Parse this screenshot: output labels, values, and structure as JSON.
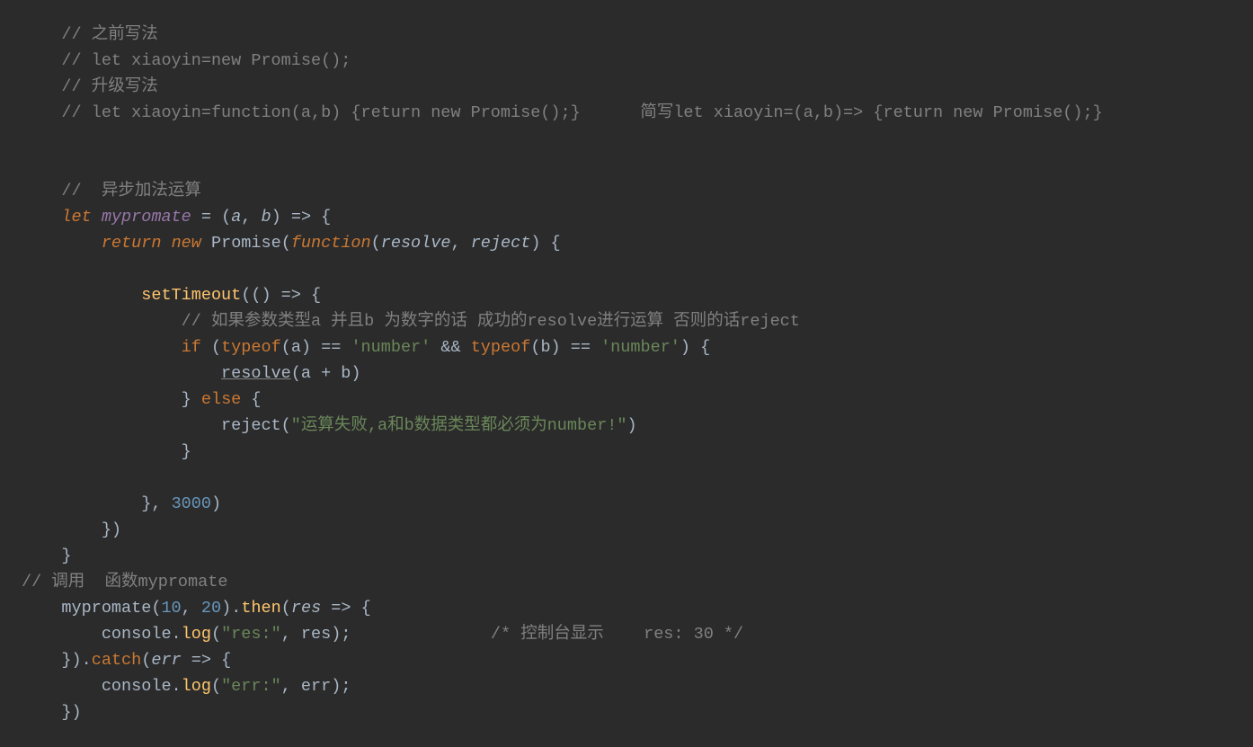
{
  "code": {
    "c1": "// 之前写法",
    "c2": "// let xiaoyin=new Promise();",
    "c3": "// 升级写法",
    "c4": "// let xiaoyin=function(a,b) {return new Promise();}      简写let xiaoyin=(a,b)=> {return new Promise();}",
    "c5": "//  异步加法运算",
    "c6": "// 如果参数类型a 并且b 为数字的话 成功的resolve进行运算 否则的话reject",
    "c7": "// 调用  函数mypromate",
    "c8": "/* 控制台显示    res: 30 */",
    "kw_let": "let",
    "kw_return": "return",
    "kw_new": "new",
    "kw_function": "function",
    "kw_if": "if",
    "kw_else": "else",
    "kw_typeof": "typeof",
    "id_mypromate": "mypromate",
    "id_promise": "Promise",
    "id_settimeout": "setTimeout",
    "id_resolve": "resolve",
    "id_resolve_call": "resolve",
    "id_reject": "reject",
    "id_reject_call": "reject",
    "id_a": "a",
    "id_b": "b",
    "id_res": "res",
    "id_err": "err",
    "id_then": "then",
    "id_catch": "catch",
    "id_console": "console",
    "id_log": "log",
    "str_number": "'number'",
    "str_fail": "\"运算失败,a和b数据类型都必须为number!\"",
    "str_res": "\"res:\"",
    "str_err": "\"err:\"",
    "num_3000": "3000",
    "num_10": "10",
    "num_20": "20",
    "ops": {
      "eq": " = ",
      "arrow": " => ",
      "arrow2": " => ",
      "arrow3": " => ",
      "arrow4": " => ",
      "eqeq": " == ",
      "and": " && ",
      "plus": " + ",
      "comma": ", ",
      "dot": "."
    }
  }
}
